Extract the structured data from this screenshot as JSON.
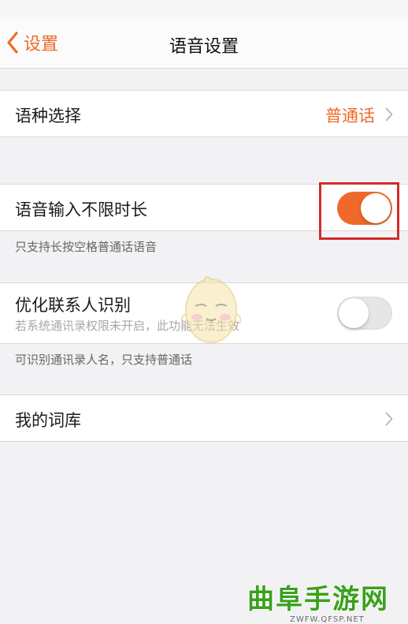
{
  "nav": {
    "back_label": "设置",
    "title": "语音设置"
  },
  "rows": {
    "language": {
      "label": "语种选择",
      "value": "普通话"
    },
    "unlimited_input": {
      "label": "语音输入不限时长",
      "toggle_on": true,
      "footnote": "只支持长按空格普通话语音"
    },
    "contact_recognition": {
      "label": "优化联系人识别",
      "sublabel": "若系统通讯录权限未开启，此功能无法生效",
      "toggle_on": false,
      "footnote": "可识别通讯录人名，只支持普通话"
    },
    "lexicon": {
      "label": "我的词库"
    }
  },
  "watermark": {
    "main": "曲阜手游网",
    "sub": "ZWFW.QFSP.NET"
  },
  "colors": {
    "accent": "#ef6a2a",
    "highlight_box": "#d42a2a",
    "watermark_green": "#3aa11c"
  },
  "icons": [
    "chevron-left-icon",
    "chevron-right-icon",
    "toggle-switch",
    "mascot-watermark"
  ]
}
